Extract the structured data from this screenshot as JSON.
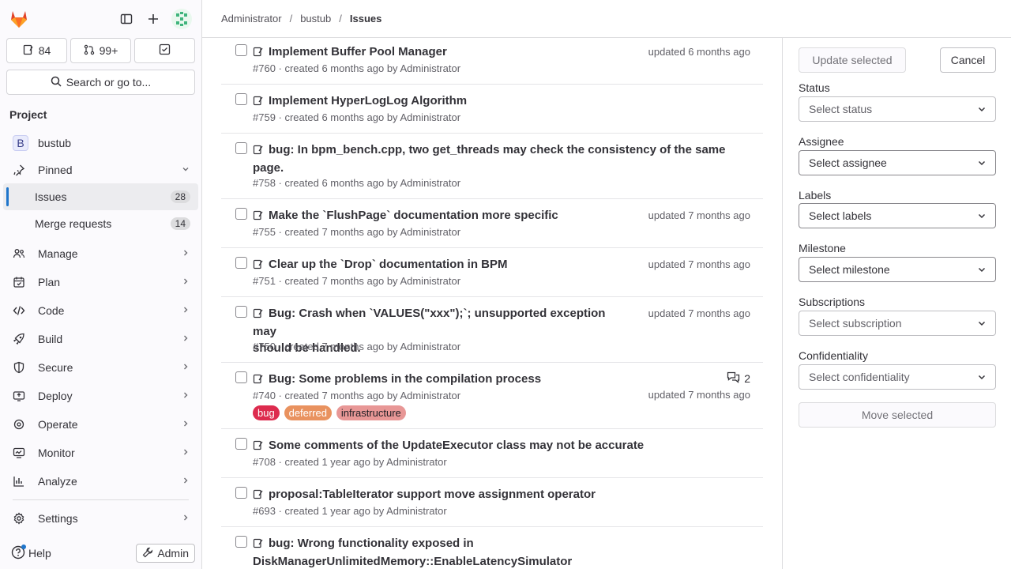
{
  "sidebar": {
    "counts": {
      "issues": "84",
      "merge_requests": "99+"
    },
    "search_label": "Search or go to...",
    "section_title": "Project",
    "project": {
      "letter": "B",
      "name": "bustub"
    },
    "pinned_label": "Pinned",
    "pinned_items": [
      {
        "label": "Issues",
        "count": "28"
      },
      {
        "label": "Merge requests",
        "count": "14"
      }
    ],
    "nav": [
      "Manage",
      "Plan",
      "Code",
      "Build",
      "Secure",
      "Deploy",
      "Operate",
      "Monitor",
      "Analyze"
    ],
    "settings_label": "Settings",
    "help_label": "Help",
    "admin_label": "Admin"
  },
  "breadcrumb": [
    "Administrator",
    "bustub",
    "Issues"
  ],
  "issues": [
    {
      "title": "Implement Buffer Pool Manager",
      "meta": "#760 · created 6 months ago by Administrator",
      "updated": "updated 6 months ago"
    },
    {
      "title": "Implement HyperLogLog Algorithm",
      "meta": "#759 · created 6 months ago by Administrator",
      "updated": ""
    },
    {
      "title": "bug: In bpm_bench.cpp, two get_threads may check the consistency of the same",
      "title2": "page.",
      "meta": "#758 · created 6 months ago by Administrator",
      "updated": ""
    },
    {
      "title": "Make the `FlushPage` documentation more specific",
      "meta": "#755 · created 7 months ago by Administrator",
      "updated": "updated 7 months ago"
    },
    {
      "title": "Clear up the `Drop` documentation in BPM",
      "meta": "#751 · created 7 months ago by Administrator",
      "updated": "updated 7 months ago"
    },
    {
      "title": "Bug: Crash when `VALUES(\"xxx\");`; unsupported exception may",
      "title2": "should be handled.",
      "meta": "#750 · created 7 months ago by Administrator",
      "updated": "updated 7 months ago"
    },
    {
      "title": "Bug: Some problems in the compilation process",
      "meta": "#740 · created 7 months ago by Administrator",
      "updated": "updated 7 months ago",
      "comments": "2",
      "labels": [
        "bug",
        "deferred",
        "infrastructure"
      ]
    },
    {
      "title": "Some comments of the UpdateExecutor class may not be accurate",
      "meta": "#708 · created 1 year ago by Administrator",
      "updated": ""
    },
    {
      "title": "proposal:TableIterator support move assignment operator",
      "meta": "#693 · created 1 year ago by Administrator",
      "updated": ""
    },
    {
      "title": "bug: Wrong functionality exposed in",
      "title2": "DiskManagerUnlimitedMemory::EnableLatencySimulator",
      "meta": "",
      "updated": ""
    }
  ],
  "label_colors": {
    "bug": "#dd2b4e",
    "deferred": "#e9925f",
    "infrastructure": "#e89796"
  },
  "panel": {
    "update_label": "Update selected",
    "cancel_label": "Cancel",
    "fields": [
      {
        "label": "Status",
        "placeholder": "Select status"
      },
      {
        "label": "Assignee",
        "placeholder": "Select assignee"
      },
      {
        "label": "Labels",
        "placeholder": "Select labels"
      },
      {
        "label": "Milestone",
        "placeholder": "Select milestone"
      },
      {
        "label": "Subscriptions",
        "placeholder": "Select subscription"
      },
      {
        "label": "Confidentiality",
        "placeholder": "Select confidentiality"
      }
    ],
    "move_label": "Move selected"
  }
}
